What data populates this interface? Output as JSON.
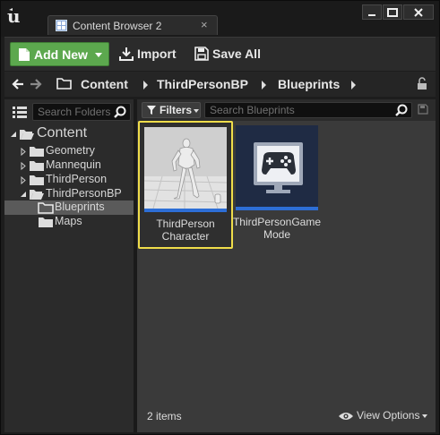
{
  "window": {
    "tab_title": "Content Browser 2",
    "tab_close_glyph": "×",
    "controls": [
      "minimize",
      "maximize",
      "close"
    ]
  },
  "toolbar": {
    "add_new_label": "Add New",
    "import_label": "Import",
    "save_all_label": "Save All",
    "accent_color": "#5ca84e"
  },
  "path": {
    "crumbs": [
      "Content",
      "ThirdPersonBP",
      "Blueprints"
    ]
  },
  "folders": {
    "search_placeholder": "Search Folders",
    "tree": [
      {
        "label": "Content",
        "expanded": true,
        "level": 0
      },
      {
        "label": "Geometry",
        "expanded": false,
        "level": 1
      },
      {
        "label": "Mannequin",
        "expanded": false,
        "level": 1
      },
      {
        "label": "ThirdPerson",
        "expanded": false,
        "level": 1
      },
      {
        "label": "ThirdPersonBP",
        "expanded": true,
        "level": 1
      },
      {
        "label": "Blueprints",
        "selected": true,
        "level": 2
      },
      {
        "label": "Maps",
        "level": 2
      }
    ]
  },
  "assets": {
    "filters_label": "Filters",
    "search_placeholder": "Search Blueprints",
    "items": [
      {
        "line1": "ThirdPerson",
        "line2": "Character",
        "selected": true,
        "icon": "mannequin-thumbnail"
      },
      {
        "line1": "ThirdPersonGame",
        "line2": "Mode",
        "selected": false,
        "icon": "gamepad-monitor-thumbnail"
      }
    ],
    "type_color": "#2d6ed6",
    "selection_color": "#f0dd4a",
    "status": "2 items",
    "view_options_label": "View Options"
  }
}
